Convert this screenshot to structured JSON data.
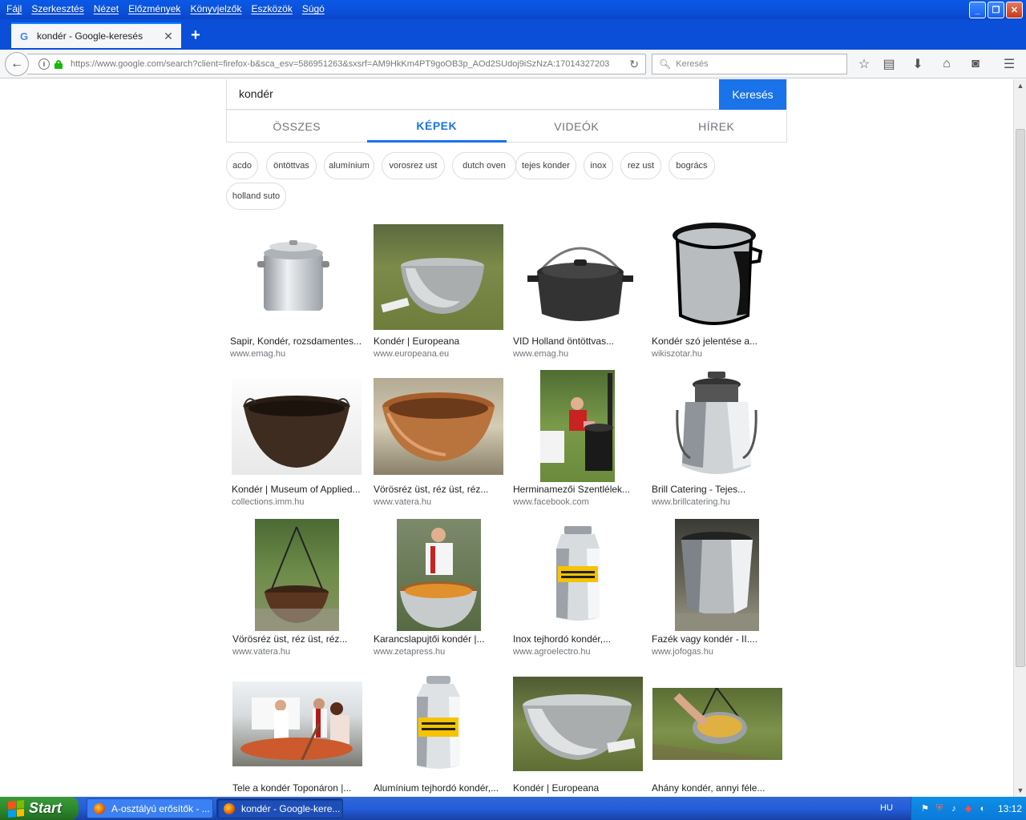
{
  "menu": [
    "Fájl",
    "Szerkesztés",
    "Nézet",
    "Előzmények",
    "Könyvjelzők",
    "Eszközök",
    "Súgó"
  ],
  "tab": {
    "title": "kondér - Google-keresés"
  },
  "urlbar": {
    "url": "https://www.google.com/search?client=firefox-b&sca_esv=586951263&sxsrf=AM9HkKm4PT9goOB3p_AOd2SUdoj9iSzNzA:17014327203"
  },
  "searchbar": {
    "placeholder": "Keresés"
  },
  "google": {
    "query": "kondér",
    "search_button": "Keresés",
    "tabs": [
      {
        "label": "ÖSSZES"
      },
      {
        "label": "KÉPEK"
      },
      {
        "label": "VIDEÓK"
      },
      {
        "label": "HÍREK"
      }
    ],
    "chips": [
      "acdo",
      "öntöttvas",
      "alumínium",
      "vorosrez ust",
      "dutch oven",
      "tejes konder",
      "inox",
      "rez ust",
      "bogrács",
      "holland suto"
    ]
  },
  "results": [
    {
      "title": "Sapir, Kondér, rozsdamentes...",
      "site": "www.emag.hu"
    },
    {
      "title": "Kondér | Europeana",
      "site": "www.europeana.eu"
    },
    {
      "title": "VID Holland öntöttvas...",
      "site": "www.emag.hu"
    },
    {
      "title": "Kondér szó jelentése a...",
      "site": "wikiszotar.hu"
    },
    {
      "title": "Kondér | Museum of Applied...",
      "site": "collections.imm.hu"
    },
    {
      "title": "Vörösréz üst, réz üst, réz...",
      "site": "www.vatera.hu"
    },
    {
      "title": "Herminamezői Szentlélek...",
      "site": "www.facebook.com"
    },
    {
      "title": "Brill Catering - Tejes...",
      "site": "www.brillcatering.hu"
    },
    {
      "title": "Vörösréz üst, réz üst, réz...",
      "site": "www.vatera.hu"
    },
    {
      "title": "Karancslapujtői kondér |...",
      "site": "www.zetapress.hu"
    },
    {
      "title": "Inox tejhordó kondér,...",
      "site": "www.agroelectro.hu"
    },
    {
      "title": "Fazék vagy kondér - II....",
      "site": "www.jofogas.hu"
    },
    {
      "title": "Tele a kondér Toponáron |...",
      "site": ""
    },
    {
      "title": "Alumínium tejhordó kondér,...",
      "site": ""
    },
    {
      "title": "Kondér | Europeana",
      "site": ""
    },
    {
      "title": "Ahány kondér, annyi féle...",
      "site": ""
    }
  ],
  "taskbar": {
    "start_label": "Start",
    "tasks": [
      "A-osztályú erősítők - ...",
      "kondér - Google-kere..."
    ],
    "lang": "HU",
    "clock": "13:12"
  }
}
